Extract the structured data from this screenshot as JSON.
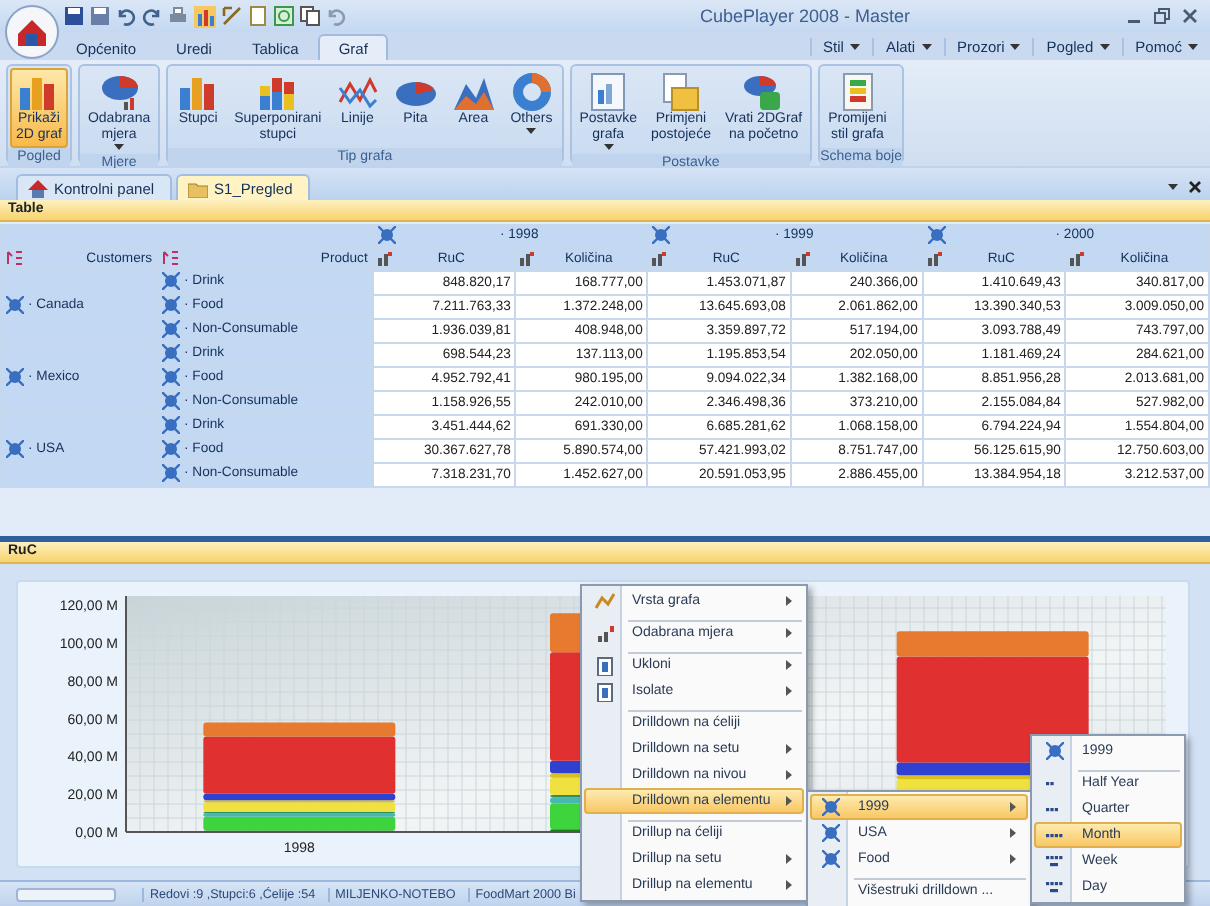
{
  "window": {
    "title": "CubePlayer 2008 - Master"
  },
  "ribbon": {
    "tabs": [
      {
        "label": "Općenito",
        "selected": false
      },
      {
        "label": "Uredi",
        "selected": false
      },
      {
        "label": "Tablica",
        "selected": false
      },
      {
        "label": "Graf",
        "selected": true
      }
    ],
    "menus": [
      "Stil",
      "Alati",
      "Prozori",
      "Pogled",
      "Pomoć"
    ],
    "groups": [
      {
        "label": "Pogled",
        "buttons": [
          {
            "lines": [
              "Prikaži",
              "2D graf"
            ],
            "kind": "bars",
            "selected": true,
            "dropdown": false
          }
        ]
      },
      {
        "label": "Mjere",
        "buttons": [
          {
            "lines": [
              "Odabrana",
              "mjera"
            ],
            "kind": "measure",
            "selected": false,
            "dropdown": true
          }
        ]
      },
      {
        "label": "Tip grafa",
        "buttons": [
          {
            "lines": [
              "Stupci"
            ],
            "kind": "bars",
            "selected": false,
            "dropdown": false
          },
          {
            "lines": [
              "Superponirani",
              "stupci"
            ],
            "kind": "stacked",
            "selected": false,
            "dropdown": false
          },
          {
            "lines": [
              "Linije"
            ],
            "kind": "line",
            "selected": false,
            "dropdown": false
          },
          {
            "lines": [
              "Pita"
            ],
            "kind": "pie",
            "selected": false,
            "dropdown": false
          },
          {
            "lines": [
              "Area"
            ],
            "kind": "area",
            "selected": false,
            "dropdown": false
          },
          {
            "lines": [
              "Others"
            ],
            "kind": "donut",
            "selected": false,
            "dropdown": true
          }
        ]
      },
      {
        "label": "Postavke",
        "buttons": [
          {
            "lines": [
              "Postavke",
              "grafa"
            ],
            "kind": "settings",
            "selected": false,
            "dropdown": true
          },
          {
            "lines": [
              "Primjeni",
              "postojeće"
            ],
            "kind": "apply",
            "selected": false,
            "dropdown": false
          },
          {
            "lines": [
              "Vrati 2DGraf",
              "na početno"
            ],
            "kind": "reset",
            "selected": false,
            "dropdown": false
          }
        ]
      },
      {
        "label": "Schema boje",
        "buttons": [
          {
            "lines": [
              "Promijeni",
              "stil grafa"
            ],
            "kind": "palette",
            "selected": false,
            "dropdown": false
          }
        ]
      }
    ]
  },
  "documents": {
    "tabs": [
      {
        "label": "Kontrolni panel",
        "selected": false
      },
      {
        "label": "S1_Pregled",
        "selected": true
      }
    ]
  },
  "table_panel": {
    "title": "Table",
    "years": [
      "· 1998",
      "· 1999",
      "· 2000"
    ],
    "row_headers": [
      "Customers",
      "Product"
    ],
    "measures": [
      "RuC",
      "Količina",
      "RuC",
      "Količina",
      "RuC",
      "Količina"
    ],
    "groups": [
      {
        "customer": "· Canada",
        "rows": [
          {
            "product": "· Drink",
            "cells": [
              "848.820,17",
              "168.777,00",
              "1.453.071,87",
              "240.366,00",
              "1.410.649,43",
              "340.817,00"
            ]
          },
          {
            "product": "· Food",
            "cells": [
              "7.211.763,33",
              "1.372.248,00",
              "13.645.693,08",
              "2.061.862,00",
              "13.390.340,53",
              "3.009.050,00"
            ]
          },
          {
            "product": "· Non-Consumable",
            "cells": [
              "1.936.039,81",
              "408.948,00",
              "3.359.897,72",
              "517.194,00",
              "3.093.788,49",
              "743.797,00"
            ]
          }
        ]
      },
      {
        "customer": "· Mexico",
        "rows": [
          {
            "product": "· Drink",
            "cells": [
              "698.544,23",
              "137.113,00",
              "1.195.853,54",
              "202.050,00",
              "1.181.469,24",
              "284.621,00"
            ]
          },
          {
            "product": "· Food",
            "cells": [
              "4.952.792,41",
              "980.195,00",
              "9.094.022,34",
              "1.382.168,00",
              "8.851.956,28",
              "2.013.681,00"
            ]
          },
          {
            "product": "· Non-Consumable",
            "cells": [
              "1.158.926,55",
              "242.010,00",
              "2.346.498,36",
              "373.210,00",
              "2.155.084,84",
              "527.982,00"
            ]
          }
        ]
      },
      {
        "customer": "· USA",
        "rows": [
          {
            "product": "· Drink",
            "cells": [
              "3.451.444,62",
              "691.330,00",
              "6.685.281,62",
              "1.068.158,00",
              "6.794.224,94",
              "1.554.804,00"
            ]
          },
          {
            "product": "· Food",
            "cells": [
              "30.367.627,78",
              "5.890.574,00",
              "57.421.993,02",
              "8.751.747,00",
              "56.125.615,90",
              "12.750.603,00"
            ]
          },
          {
            "product": "· Non-Consumable",
            "cells": [
              "7.318.231,70",
              "1.452.627,00",
              "20.591.053,95",
              "2.886.455,00",
              "13.384.954,18",
              "3.212.537,00"
            ]
          }
        ]
      }
    ]
  },
  "chart_panel": {
    "title": "RuC",
    "y_axis_labels": [
      "120,00 M",
      "100,00 M",
      "80,00 M",
      "60,00 M",
      "40,00 M",
      "20,00 M",
      "0,00 M"
    ],
    "x_axis_labels": [
      "1998"
    ]
  },
  "context_menu": {
    "items": [
      {
        "label": "Vrsta grafa",
        "kind": "chart",
        "submenu": true,
        "separator_before": false,
        "selected": false
      },
      {
        "label": "Odabrana mjera",
        "kind": "measure",
        "submenu": true,
        "separator_before": true,
        "selected": false
      },
      {
        "label": "Ukloni",
        "kind": "remove",
        "submenu": true,
        "separator_before": true,
        "selected": false
      },
      {
        "label": "Isolate",
        "kind": "remove",
        "submenu": true,
        "separator_before": false,
        "selected": false
      },
      {
        "label": "Drilldown na ćeliji",
        "kind": "plain",
        "submenu": false,
        "separator_before": true,
        "selected": false
      },
      {
        "label": "Drilldown na setu",
        "kind": "plain",
        "submenu": true,
        "separator_before": false,
        "selected": false
      },
      {
        "label": "Drilldown na nivou",
        "kind": "plain",
        "submenu": true,
        "separator_before": false,
        "selected": false
      },
      {
        "label": "Drilldown na elementu",
        "kind": "plain",
        "submenu": true,
        "separator_before": false,
        "selected": true
      },
      {
        "label": "Drillup na ćeliji",
        "kind": "plain",
        "submenu": false,
        "separator_before": true,
        "selected": false
      },
      {
        "label": "Drillup na setu",
        "kind": "plain",
        "submenu": true,
        "separator_before": false,
        "selected": false
      },
      {
        "label": "Drillup na elementu",
        "kind": "plain",
        "submenu": true,
        "separator_before": false,
        "selected": false
      }
    ]
  },
  "element_menu": {
    "items": [
      {
        "label": "1999",
        "kind": "cube",
        "submenu": true,
        "separator_before": false,
        "selected": true
      },
      {
        "label": "USA",
        "kind": "cube",
        "submenu": true,
        "separator_before": false,
        "selected": false
      },
      {
        "label": "Food",
        "kind": "cube",
        "submenu": true,
        "separator_before": false,
        "selected": false
      },
      {
        "label": "Višestruki drilldown ...",
        "kind": "plain",
        "submenu": false,
        "separator_before": true,
        "selected": false
      }
    ]
  },
  "level_menu": {
    "items": [
      {
        "label": "1999",
        "kind": "cube",
        "submenu": false,
        "separator_before": false,
        "selected": false
      },
      {
        "label": "Half Year",
        "kind": "level1",
        "submenu": false,
        "separator_before": true,
        "selected": false
      },
      {
        "label": "Quarter",
        "kind": "level2",
        "submenu": false,
        "separator_before": false,
        "selected": false
      },
      {
        "label": "Month",
        "kind": "level3",
        "submenu": false,
        "separator_before": false,
        "selected": true
      },
      {
        "label": "Week",
        "kind": "level4",
        "submenu": false,
        "separator_before": false,
        "selected": false
      },
      {
        "label": "Day",
        "kind": "level4",
        "submenu": false,
        "separator_before": false,
        "selected": false
      }
    ]
  },
  "status_bar": {
    "fields": [
      "Redovi :9 ,Stupci:6 ,Ćelije :54",
      "MILJENKO-NOTEBO",
      "FoodMart 2000 Bi"
    ]
  }
}
